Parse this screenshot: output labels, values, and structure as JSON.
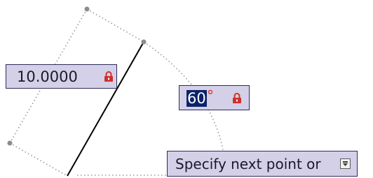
{
  "length_input": {
    "value": "10.0000",
    "lock_icon": "padlock-icon"
  },
  "angle_input": {
    "value": "60",
    "unit": "°",
    "lock_icon": "padlock-icon"
  },
  "command_prompt": {
    "text": "Specify next point or",
    "options_icon": "down-arrow-icon"
  },
  "colors": {
    "input_background": "#d4d0e8",
    "input_border": "#2e2a5e",
    "selection": "#0a246a",
    "lock": "#d0302a",
    "line": "#000000",
    "dotted_guide": "#999999"
  }
}
